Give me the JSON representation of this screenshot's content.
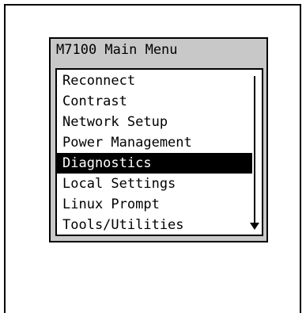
{
  "menu": {
    "title": "M7100 Main Menu",
    "selected_index": 4,
    "items": [
      {
        "label": "Reconnect"
      },
      {
        "label": "Contrast"
      },
      {
        "label": "Network Setup"
      },
      {
        "label": "Power Management"
      },
      {
        "label": "Diagnostics"
      },
      {
        "label": "Local Settings"
      },
      {
        "label": "Linux Prompt"
      },
      {
        "label": "Tools/Utilities"
      }
    ],
    "scroll_icon": "scroll-down-arrow-icon"
  }
}
